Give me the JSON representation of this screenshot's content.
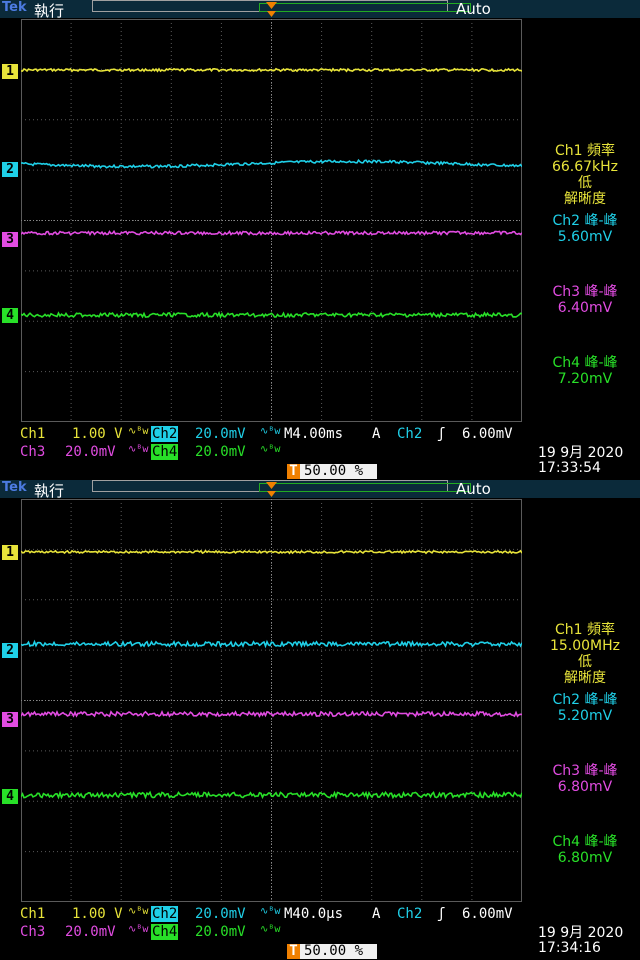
{
  "brand": "Tek",
  "colors": {
    "ch1": "#e8e43a",
    "ch2": "#1fd0e8",
    "ch3": "#e24ce2",
    "ch4": "#28e028",
    "grid": "#5a5a5a",
    "trigger": "#f08000"
  },
  "screens": [
    {
      "run_state": "執行",
      "trigger_mode": "Auto",
      "channel_markers": [
        "1",
        "2",
        "3",
        "4"
      ],
      "measurements": {
        "ch1": {
          "label": "Ch1 頻率",
          "value": "66.67kHz",
          "note1": "低",
          "note2": "解晰度"
        },
        "ch2": {
          "label": "Ch2 峰-峰",
          "value": "5.60mV"
        },
        "ch3": {
          "label": "Ch3 峰-峰",
          "value": "6.40mV"
        },
        "ch4": {
          "label": "Ch4 峰-峰",
          "value": "7.20mV"
        }
      },
      "status": {
        "ch1_label": "Ch1",
        "ch1_scale": "1.00 V",
        "ch2_label": "Ch2",
        "ch2_scale": "20.0mV",
        "ch3_label": "Ch3",
        "ch3_scale": "20.0mV",
        "ch4_label": "Ch4",
        "ch4_scale": "20.0mV",
        "timebase": "M4.00ms",
        "acq": "A",
        "trig_source": "Ch2",
        "trig_level": "6.00mV",
        "trig_position": "50.00 %",
        "date": "19 9月  2020",
        "time": "17:33:54"
      }
    },
    {
      "run_state": "執行",
      "trigger_mode": "Auto",
      "channel_markers": [
        "1",
        "2",
        "3",
        "4"
      ],
      "measurements": {
        "ch1": {
          "label": "Ch1 頻率",
          "value": "15.00MHz",
          "note1": "低",
          "note2": "解晰度"
        },
        "ch2": {
          "label": "Ch2 峰-峰",
          "value": "5.20mV"
        },
        "ch3": {
          "label": "Ch3 峰-峰",
          "value": "6.80mV"
        },
        "ch4": {
          "label": "Ch4 峰-峰",
          "value": "6.80mV"
        }
      },
      "status": {
        "ch1_label": "Ch1",
        "ch1_scale": "1.00 V",
        "ch2_label": "Ch2",
        "ch2_scale": "20.0mV",
        "ch3_label": "Ch3",
        "ch3_scale": "20.0mV",
        "ch4_label": "Ch4",
        "ch4_scale": "20.0mV",
        "timebase": "M40.0µs",
        "acq": "A",
        "trig_source": "Ch2",
        "trig_level": "6.00mV",
        "trig_position": "50.00 %",
        "date": "19 9月  2020",
        "time": "17:34:16"
      }
    }
  ]
}
